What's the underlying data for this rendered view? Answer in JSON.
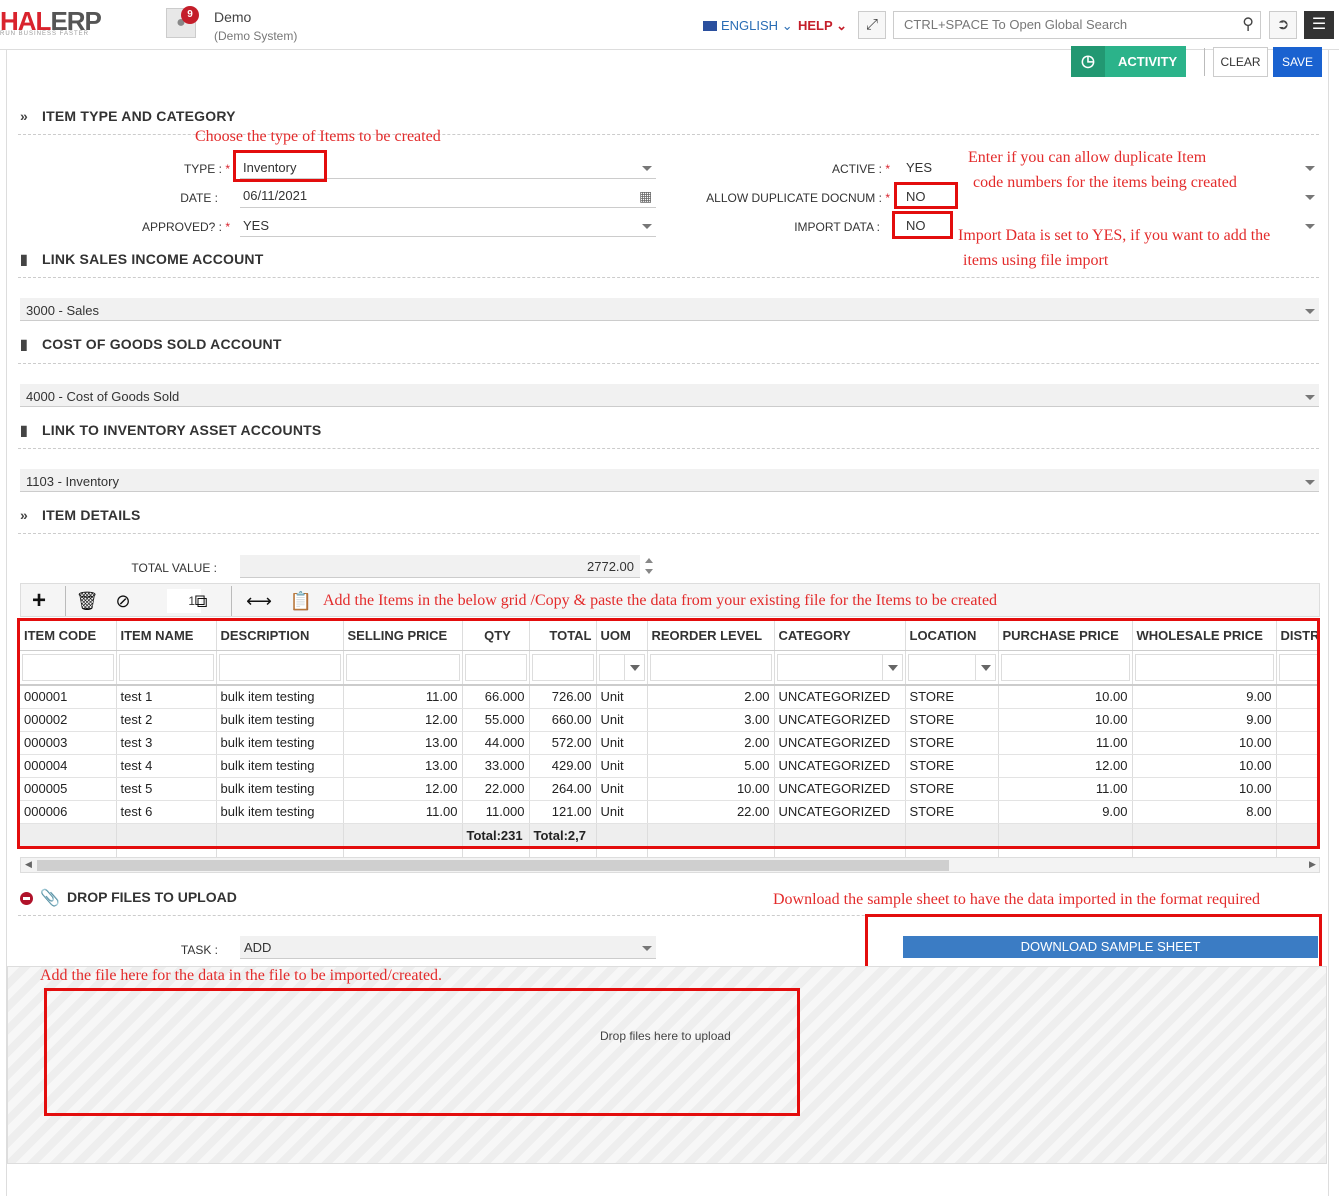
{
  "header": {
    "logo_main": "HAL",
    "logo_erp": "ERP",
    "logo_tagline": "RUN BUSINESS FASTER",
    "notification_count": "9",
    "user_name": "Demo",
    "user_sub": "(Demo System)",
    "language": "ENGLISH",
    "help": "HELP",
    "search_placeholder": "CTRL+SPACE To Open Global Search"
  },
  "actions": {
    "activity": "ACTIVITY",
    "clear": "CLEAR",
    "save": "SAVE"
  },
  "sections": {
    "item_type": "ITEM TYPE AND CATEGORY",
    "sales_income": "LINK SALES INCOME ACCOUNT",
    "cogs": "COST OF GOODS SOLD ACCOUNT",
    "inventory_asset": "LINK TO INVENTORY ASSET ACCOUNTS",
    "item_details": "ITEM DETAILS",
    "drop_files": "DROP FILES TO UPLOAD"
  },
  "form": {
    "type_label": "TYPE :",
    "type_value": "Inventory",
    "date_label": "DATE :",
    "date_value": "06/11/2021",
    "approved_label": "APPROVED? :",
    "approved_value": "YES",
    "active_label": "ACTIVE :",
    "active_value": "YES",
    "dup_label": "ALLOW DUPLICATE DOCNUM :",
    "dup_value": "NO",
    "import_label": "IMPORT DATA :",
    "import_value": "NO",
    "sales_account": "3000 - Sales",
    "cogs_account": "4000 - Cost of Goods Sold",
    "inventory_account": "1103 - Inventory",
    "total_value_label": "TOTAL VALUE :",
    "total_value": "2772.00",
    "task_label": "TASK :",
    "task_value": "ADD",
    "page_number": "1"
  },
  "annotations": {
    "type_note": "Choose the type of Items to be created",
    "dup_note_1": "Enter if you can allow duplicate Item",
    "dup_note_2": "code numbers for the items being created",
    "import_note_1": "Import Data is set to YES, if you want to add the",
    "import_note_2": "items using file import",
    "grid_note": "Add the Items in the below grid /Copy & paste the data from your existing file for the Items to be created",
    "download_note": "Download the sample sheet to have the data imported in the format required",
    "drop_note": "Add the file here for the data in the file to be imported/created."
  },
  "grid": {
    "columns": [
      "ITEM CODE",
      "ITEM NAME",
      "DESCRIPTION",
      "SELLING PRICE",
      "QTY",
      "TOTAL",
      "UOM",
      "REORDER LEVEL",
      "CATEGORY",
      "LOCATION",
      "PURCHASE PRICE",
      "WHOLESALE PRICE",
      "DISTR"
    ],
    "rows": [
      [
        "000001",
        "test 1",
        "bulk item testing",
        "11.00",
        "66.000",
        "726.00",
        "Unit",
        "2.00",
        "UNCATEGORIZED",
        "STORE",
        "10.00",
        "9.00",
        ""
      ],
      [
        "000002",
        "test 2",
        "bulk item testing",
        "12.00",
        "55.000",
        "660.00",
        "Unit",
        "3.00",
        "UNCATEGORIZED",
        "STORE",
        "10.00",
        "9.00",
        ""
      ],
      [
        "000003",
        "test 3",
        "bulk item testing",
        "13.00",
        "44.000",
        "572.00",
        "Unit",
        "2.00",
        "UNCATEGORIZED",
        "STORE",
        "11.00",
        "10.00",
        ""
      ],
      [
        "000004",
        "test 4",
        "bulk item testing",
        "13.00",
        "33.000",
        "429.00",
        "Unit",
        "5.00",
        "UNCATEGORIZED",
        "STORE",
        "12.00",
        "10.00",
        ""
      ],
      [
        "000005",
        "test 5",
        "bulk item testing",
        "12.00",
        "22.000",
        "264.00",
        "Unit",
        "10.00",
        "UNCATEGORIZED",
        "STORE",
        "11.00",
        "10.00",
        ""
      ],
      [
        "000006",
        "test 6",
        "bulk item testing",
        "11.00",
        "11.000",
        "121.00",
        "Unit",
        "22.00",
        "UNCATEGORIZED",
        "STORE",
        "9.00",
        "8.00",
        ""
      ]
    ],
    "qty_total": "Total:231",
    "total_total": "Total:2,7"
  },
  "upload": {
    "download_button": "DOWNLOAD SAMPLE SHEET",
    "drop_text": "Drop files here to upload"
  },
  "colors": {
    "brand_red": "#d9232d",
    "annotation_red": "#e30d0d",
    "activity_green": "#2bb38a",
    "save_blue": "#1a62d0",
    "download_blue": "#3b7cc4"
  }
}
